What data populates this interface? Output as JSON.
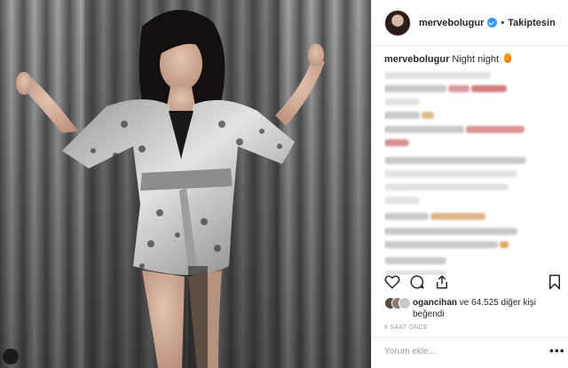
{
  "post": {
    "username": "mervebolugur",
    "dot": "•",
    "follow_label": "Takiptesin",
    "caption_text": "Night night"
  },
  "likes": {
    "user": "ogancihan",
    "text": "ve 64.525 diğer kişi beğendi"
  },
  "time_label": "8 SAAT ÖNCE",
  "comment_placeholder": "Yorum ekle...",
  "more_label": "•••",
  "icons": {
    "heart": "heart-icon",
    "comment": "comment-icon",
    "share": "share-icon",
    "save": "bookmark-icon",
    "verified": "verified-badge-icon",
    "fire": "fire-emoji-icon"
  }
}
